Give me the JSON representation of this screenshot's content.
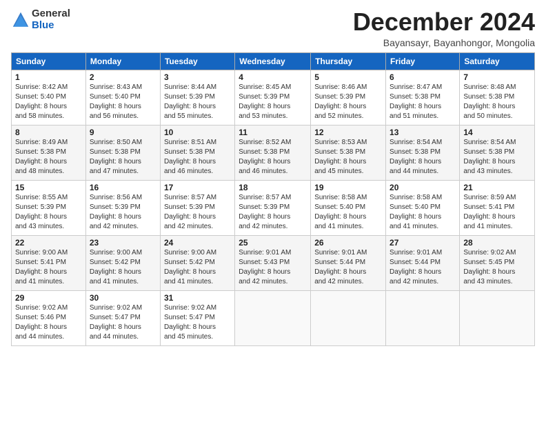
{
  "logo": {
    "general": "General",
    "blue": "Blue"
  },
  "header": {
    "month": "December 2024",
    "location": "Bayansayr, Bayanhongor, Mongolia"
  },
  "weekdays": [
    "Sunday",
    "Monday",
    "Tuesday",
    "Wednesday",
    "Thursday",
    "Friday",
    "Saturday"
  ],
  "weeks": [
    [
      {
        "day": "1",
        "info": "Sunrise: 8:42 AM\nSunset: 5:40 PM\nDaylight: 8 hours\nand 58 minutes."
      },
      {
        "day": "2",
        "info": "Sunrise: 8:43 AM\nSunset: 5:40 PM\nDaylight: 8 hours\nand 56 minutes."
      },
      {
        "day": "3",
        "info": "Sunrise: 8:44 AM\nSunset: 5:39 PM\nDaylight: 8 hours\nand 55 minutes."
      },
      {
        "day": "4",
        "info": "Sunrise: 8:45 AM\nSunset: 5:39 PM\nDaylight: 8 hours\nand 53 minutes."
      },
      {
        "day": "5",
        "info": "Sunrise: 8:46 AM\nSunset: 5:39 PM\nDaylight: 8 hours\nand 52 minutes."
      },
      {
        "day": "6",
        "info": "Sunrise: 8:47 AM\nSunset: 5:38 PM\nDaylight: 8 hours\nand 51 minutes."
      },
      {
        "day": "7",
        "info": "Sunrise: 8:48 AM\nSunset: 5:38 PM\nDaylight: 8 hours\nand 50 minutes."
      }
    ],
    [
      {
        "day": "8",
        "info": "Sunrise: 8:49 AM\nSunset: 5:38 PM\nDaylight: 8 hours\nand 48 minutes."
      },
      {
        "day": "9",
        "info": "Sunrise: 8:50 AM\nSunset: 5:38 PM\nDaylight: 8 hours\nand 47 minutes."
      },
      {
        "day": "10",
        "info": "Sunrise: 8:51 AM\nSunset: 5:38 PM\nDaylight: 8 hours\nand 46 minutes."
      },
      {
        "day": "11",
        "info": "Sunrise: 8:52 AM\nSunset: 5:38 PM\nDaylight: 8 hours\nand 46 minutes."
      },
      {
        "day": "12",
        "info": "Sunrise: 8:53 AM\nSunset: 5:38 PM\nDaylight: 8 hours\nand 45 minutes."
      },
      {
        "day": "13",
        "info": "Sunrise: 8:54 AM\nSunset: 5:38 PM\nDaylight: 8 hours\nand 44 minutes."
      },
      {
        "day": "14",
        "info": "Sunrise: 8:54 AM\nSunset: 5:38 PM\nDaylight: 8 hours\nand 43 minutes."
      }
    ],
    [
      {
        "day": "15",
        "info": "Sunrise: 8:55 AM\nSunset: 5:39 PM\nDaylight: 8 hours\nand 43 minutes."
      },
      {
        "day": "16",
        "info": "Sunrise: 8:56 AM\nSunset: 5:39 PM\nDaylight: 8 hours\nand 42 minutes."
      },
      {
        "day": "17",
        "info": "Sunrise: 8:57 AM\nSunset: 5:39 PM\nDaylight: 8 hours\nand 42 minutes."
      },
      {
        "day": "18",
        "info": "Sunrise: 8:57 AM\nSunset: 5:39 PM\nDaylight: 8 hours\nand 42 minutes."
      },
      {
        "day": "19",
        "info": "Sunrise: 8:58 AM\nSunset: 5:40 PM\nDaylight: 8 hours\nand 41 minutes."
      },
      {
        "day": "20",
        "info": "Sunrise: 8:58 AM\nSunset: 5:40 PM\nDaylight: 8 hours\nand 41 minutes."
      },
      {
        "day": "21",
        "info": "Sunrise: 8:59 AM\nSunset: 5:41 PM\nDaylight: 8 hours\nand 41 minutes."
      }
    ],
    [
      {
        "day": "22",
        "info": "Sunrise: 9:00 AM\nSunset: 5:41 PM\nDaylight: 8 hours\nand 41 minutes."
      },
      {
        "day": "23",
        "info": "Sunrise: 9:00 AM\nSunset: 5:42 PM\nDaylight: 8 hours\nand 41 minutes."
      },
      {
        "day": "24",
        "info": "Sunrise: 9:00 AM\nSunset: 5:42 PM\nDaylight: 8 hours\nand 41 minutes."
      },
      {
        "day": "25",
        "info": "Sunrise: 9:01 AM\nSunset: 5:43 PM\nDaylight: 8 hours\nand 42 minutes."
      },
      {
        "day": "26",
        "info": "Sunrise: 9:01 AM\nSunset: 5:44 PM\nDaylight: 8 hours\nand 42 minutes."
      },
      {
        "day": "27",
        "info": "Sunrise: 9:01 AM\nSunset: 5:44 PM\nDaylight: 8 hours\nand 42 minutes."
      },
      {
        "day": "28",
        "info": "Sunrise: 9:02 AM\nSunset: 5:45 PM\nDaylight: 8 hours\nand 43 minutes."
      }
    ],
    [
      {
        "day": "29",
        "info": "Sunrise: 9:02 AM\nSunset: 5:46 PM\nDaylight: 8 hours\nand 44 minutes."
      },
      {
        "day": "30",
        "info": "Sunrise: 9:02 AM\nSunset: 5:47 PM\nDaylight: 8 hours\nand 44 minutes."
      },
      {
        "day": "31",
        "info": "Sunrise: 9:02 AM\nSunset: 5:47 PM\nDaylight: 8 hours\nand 45 minutes."
      },
      {
        "day": "",
        "info": ""
      },
      {
        "day": "",
        "info": ""
      },
      {
        "day": "",
        "info": ""
      },
      {
        "day": "",
        "info": ""
      }
    ]
  ]
}
